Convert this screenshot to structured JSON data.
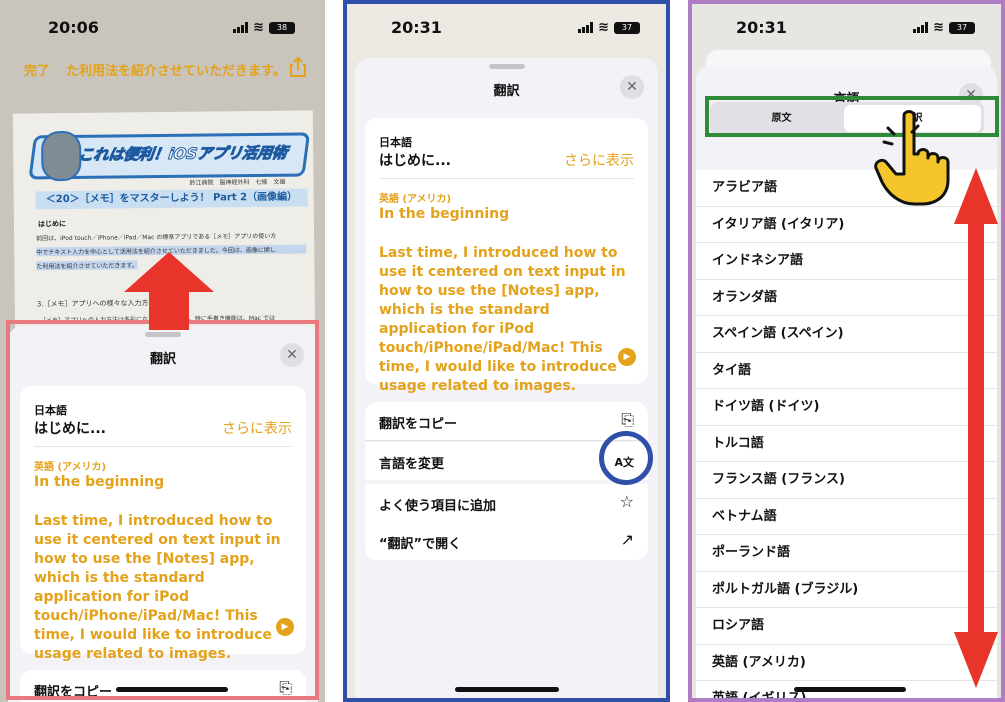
{
  "accent_color": "#e3a21a",
  "panel1": {
    "time": "20:06",
    "battery": "38",
    "done_label": "完了",
    "header_text": "た利用法を紹介させていただきます。",
    "share_icon": "share-icon",
    "doc": {
      "banner": "これは便利！iOSアプリ活用術",
      "author": "鈴江病院　脳神経外科　七條　文雄",
      "subtitle": "＜20＞［メモ］をマスターしよう！ Part 2（画像編）",
      "heading": "はじめに",
      "line1": "前回は、iPod touch／iPhone／iPad／Mac の標準アプリである［メモ］アプリの使い方",
      "line2": "中でテキスト入力を中心として活用法を紹介させていただきました。今回は、画像に関し",
      "line3": "た利用法を紹介させていただきます。",
      "line4": "3.［メモ］アプリへの様々な入力方法",
      "line5": "　［メモ］アプリへの入力方法は多彩になってきています。特に手書き機能は、Mac では"
    },
    "sheet": {
      "title": "翻訳",
      "source_lang": "日本語",
      "source_text": "はじめに...",
      "more_label": "さらに表示",
      "target_lang": "英語 (アメリカ)",
      "target_title": "In the beginning",
      "target_body": "Last time, I introduced how to use it centered on text input in how to use the [Notes] app, which is the standard application for iPod touch/iPhone/iPad/Mac! This time, I would like to introduce usage related to images.",
      "copy_label": "翻訳をコピー"
    }
  },
  "panel2": {
    "time": "20:31",
    "battery": "37",
    "sheet": {
      "title": "翻訳",
      "source_lang": "日本語",
      "source_text": "はじめに...",
      "more_label": "さらに表示",
      "target_lang": "英語 (アメリカ)",
      "target_title": "In the beginning",
      "target_body": "Last time, I introduced how to use it centered on text input in how to use the [Notes] app, which is the standard application for iPod touch/iPhone/iPad/Mac! This time, I would like to introduce usage related to images.",
      "actions": [
        {
          "label": "翻訳をコピー",
          "icon": "copy-icon",
          "glyph": "⎘"
        },
        {
          "label": "言語を変更",
          "icon": "translate-icon",
          "glyph": "A文"
        },
        {
          "label": "よく使う項目に追加",
          "icon": "star-icon",
          "glyph": "☆"
        },
        {
          "label": "“翻訳”で開く",
          "icon": "open-external-icon",
          "glyph": "↗"
        }
      ]
    }
  },
  "panel3": {
    "time": "20:31",
    "battery": "37",
    "sheet": {
      "title": "言語",
      "segment_source": "原文",
      "segment_translation": "翻訳",
      "languages": [
        "アラビア語",
        "イタリア語 (イタリア)",
        "インドネシア語",
        "オランダ語",
        "スペイン語 (スペイン)",
        "タイ語",
        "ドイツ語 (ドイツ)",
        "トルコ語",
        "フランス語 (フランス)",
        "ベトナム語",
        "ポーランド語",
        "ポルトガル語 (ブラジル)",
        "ロシア語",
        "英語 (アメリカ)",
        "英語 (イギリス)"
      ]
    }
  },
  "annotations": {
    "frame1_color": "#e9797f",
    "frame2_color": "#2f4fa8",
    "frame3_color": "#b07cc4",
    "segment_frame_color": "#2e8b3a",
    "circle_color": "#2f4fa8",
    "arrow_color": "#e8342a"
  }
}
